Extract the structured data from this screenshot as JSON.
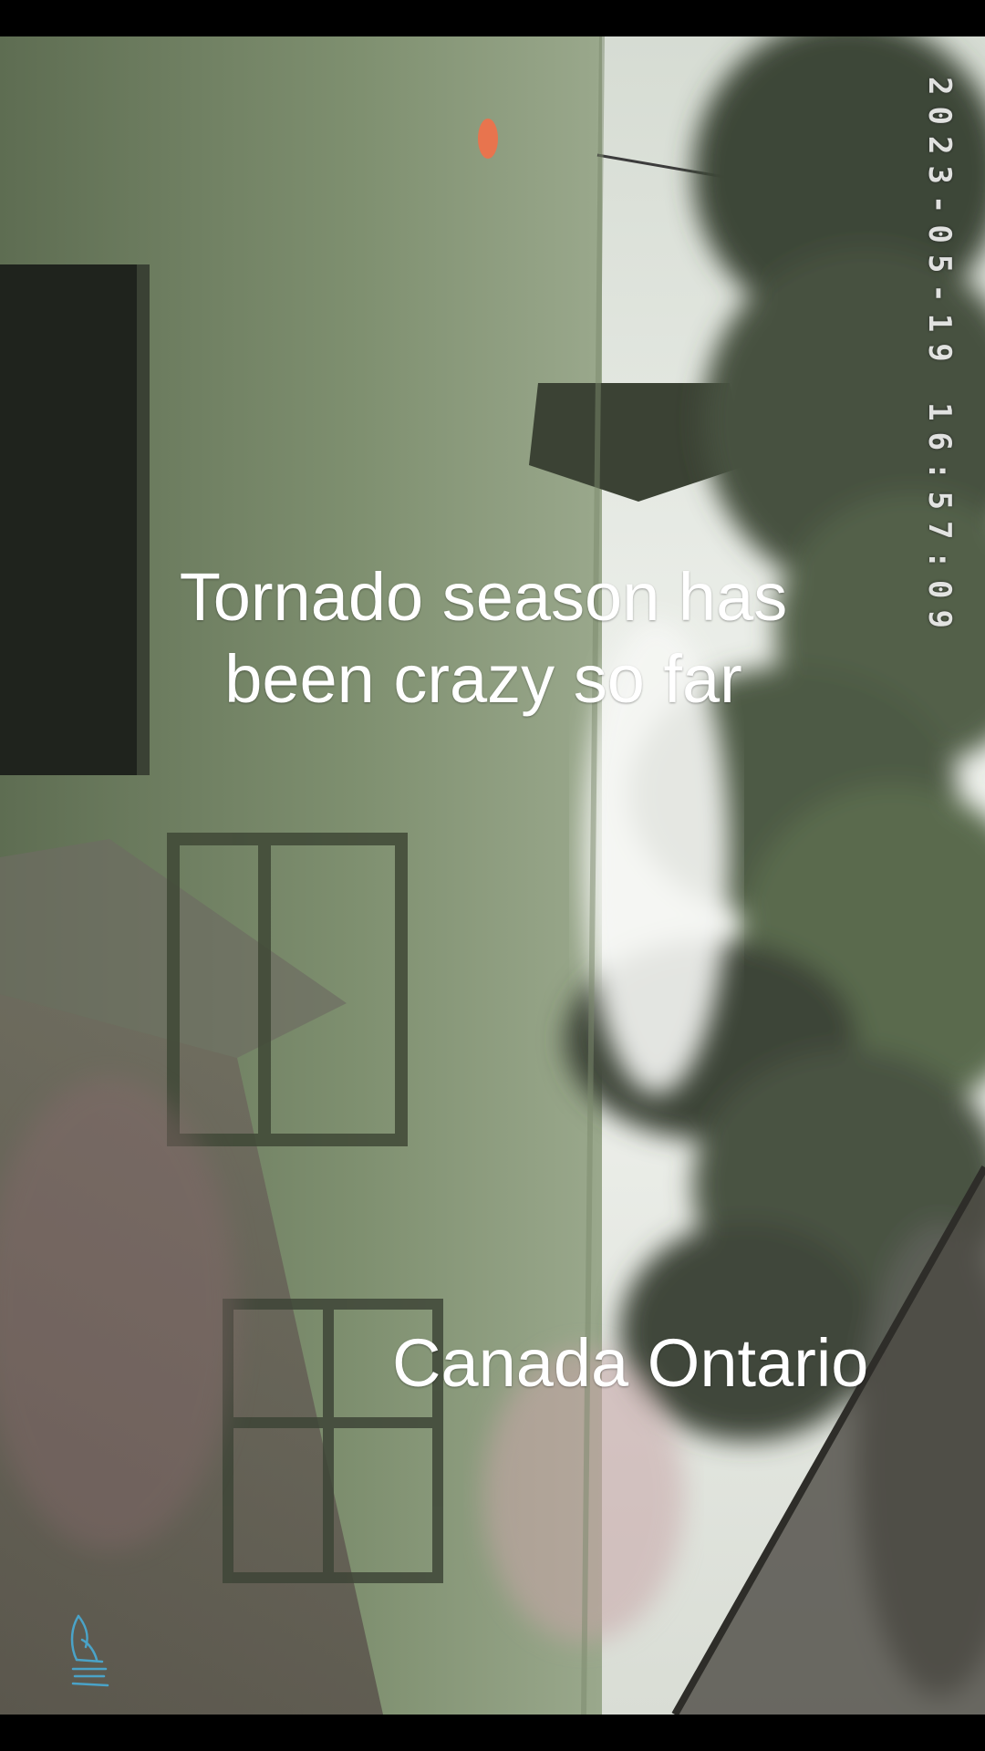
{
  "video": {
    "timestamp": "2023-05-19 16:57:09",
    "caption": {
      "line1": "Tornado season has",
      "line2": "been crazy so far"
    },
    "location_label": "Canada Ontario",
    "watermark_icon": "hand-sketch-icon"
  },
  "colors": {
    "bars": "#000000",
    "wall_green": "#7d8d6c",
    "sky": "#e8ece6",
    "trees": "#3f4a3a",
    "caption_text": "#ffffff"
  }
}
